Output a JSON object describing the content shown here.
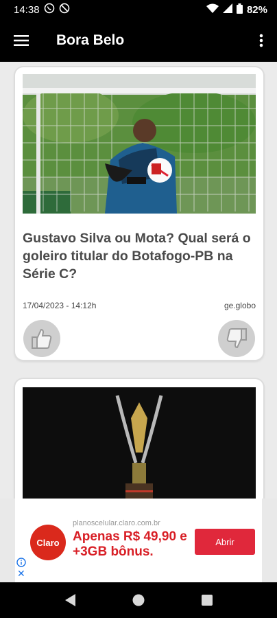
{
  "status_bar": {
    "time": "14:38",
    "battery": "82%",
    "icons": [
      "whatsapp-icon",
      "silent-icon",
      "wifi-icon",
      "signal-icon",
      "battery-icon"
    ]
  },
  "app_bar": {
    "title": "Bora Belo",
    "icons": [
      "hamburger-menu-icon",
      "more-vert-icon"
    ]
  },
  "feed": {
    "articles": [
      {
        "headline": "Gustavo Silva ou Mota? Qual será o goleiro titular do Botafogo-PB na Série C?",
        "date": "17/04/2023 - 14:12h",
        "source": "ge.globo"
      }
    ]
  },
  "ad": {
    "url": "planoscelular.claro.com.br",
    "headline": "Apenas R$ 49,90 e +3GB bônus.",
    "button_label": "Abrir",
    "logo_text": "Claro",
    "accent_color": "#da291c"
  },
  "colors": {
    "app_bar": "#000000",
    "card_text": "#4a4a4a",
    "thumb_bg": "#cfcfcf"
  }
}
